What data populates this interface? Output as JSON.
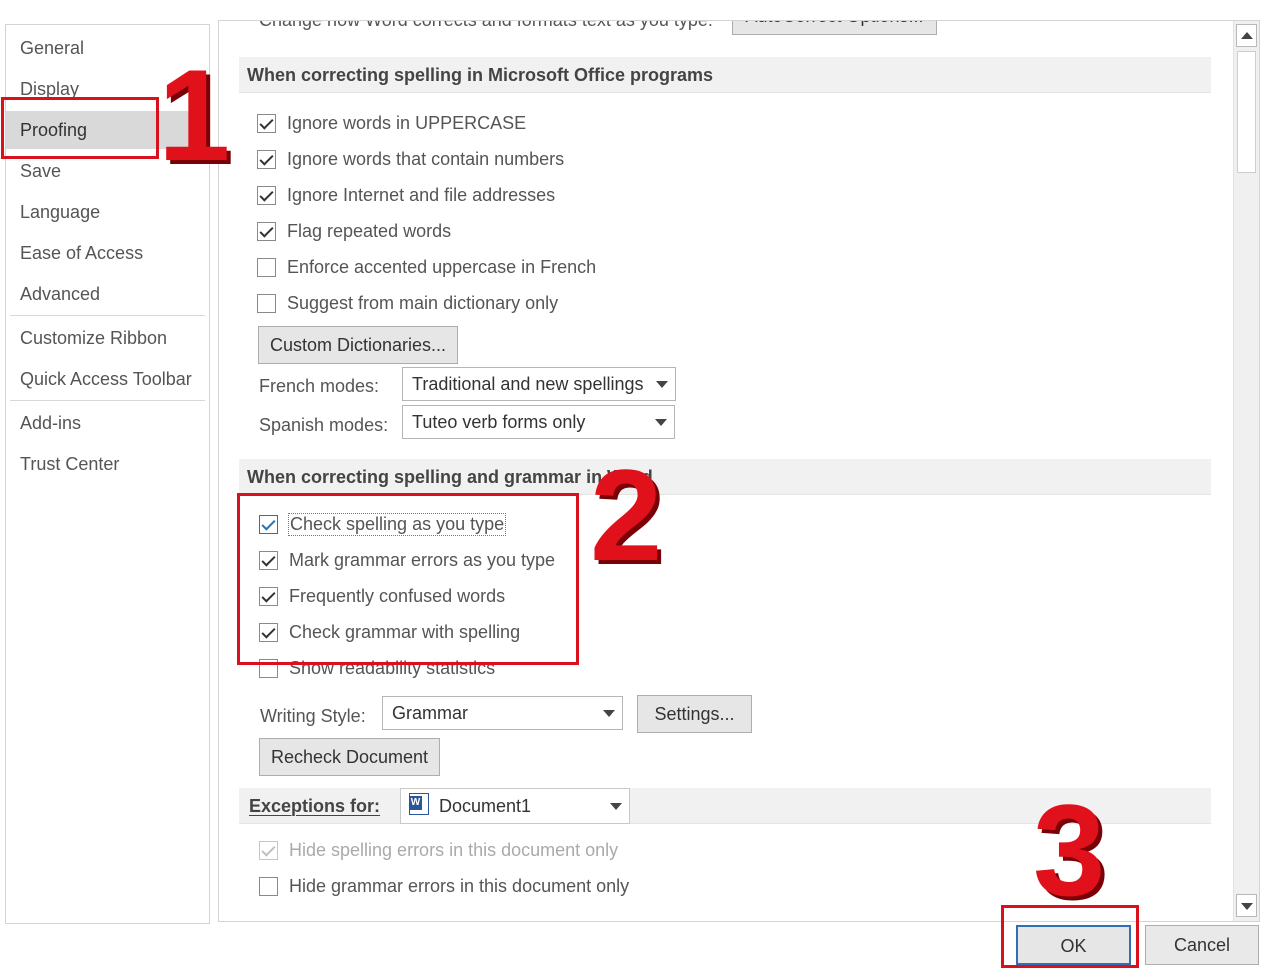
{
  "nav": {
    "items": [
      {
        "label": "General",
        "selected": false
      },
      {
        "label": "Display",
        "selected": false
      },
      {
        "label": "Proofing",
        "selected": true
      },
      {
        "label": "Save",
        "selected": false
      },
      {
        "label": "Language",
        "selected": false
      },
      {
        "label": "Ease of Access",
        "selected": false
      },
      {
        "label": "Advanced",
        "selected": false
      },
      {
        "label": "Customize Ribbon",
        "selected": false
      },
      {
        "label": "Quick Access Toolbar",
        "selected": false
      },
      {
        "label": "Add-ins",
        "selected": false
      },
      {
        "label": "Trust Center",
        "selected": false
      }
    ]
  },
  "autocorrect": {
    "text": "Change how Word corrects and formats text as you type:",
    "button": "AutoCorrect Options..."
  },
  "office_section": {
    "heading": "When correcting spelling in Microsoft Office programs",
    "options": [
      {
        "label": "Ignore words in UPPERCASE",
        "checked": true
      },
      {
        "label": "Ignore words that contain numbers",
        "checked": true
      },
      {
        "label": "Ignore Internet and file addresses",
        "checked": true
      },
      {
        "label": "Flag repeated words",
        "checked": true
      },
      {
        "label": "Enforce accented uppercase in French",
        "checked": false
      },
      {
        "label": "Suggest from main dictionary only",
        "checked": false
      }
    ],
    "custom_dictionaries": "Custom Dictionaries...",
    "french_label": "French modes:",
    "french_value": "Traditional and new spellings",
    "spanish_label": "Spanish modes:",
    "spanish_value": "Tuteo verb forms only"
  },
  "word_section": {
    "heading": "When correcting spelling and grammar in Word",
    "options": [
      {
        "label": "Check spelling as you type",
        "checked": true
      },
      {
        "label": "Mark grammar errors as you type",
        "checked": true
      },
      {
        "label": "Frequently confused words",
        "checked": true
      },
      {
        "label": "Check grammar with spelling",
        "checked": true
      },
      {
        "label": "Show readability statistics",
        "checked": false
      }
    ],
    "writing_style_label": "Writing Style:",
    "writing_style_value": "Grammar",
    "settings_button": "Settings...",
    "recheck_button": "Recheck Document"
  },
  "exceptions": {
    "label": "Exceptions for:",
    "document": "Document1",
    "options": [
      {
        "label": "Hide spelling errors in this document only",
        "checked": true
      },
      {
        "label": "Hide grammar errors in this document only",
        "checked": false
      }
    ]
  },
  "footer": {
    "ok": "OK",
    "cancel": "Cancel"
  },
  "annotations": {
    "marker_1": "1",
    "marker_2": "2",
    "marker_3": "3",
    "color": "#e0111b"
  }
}
